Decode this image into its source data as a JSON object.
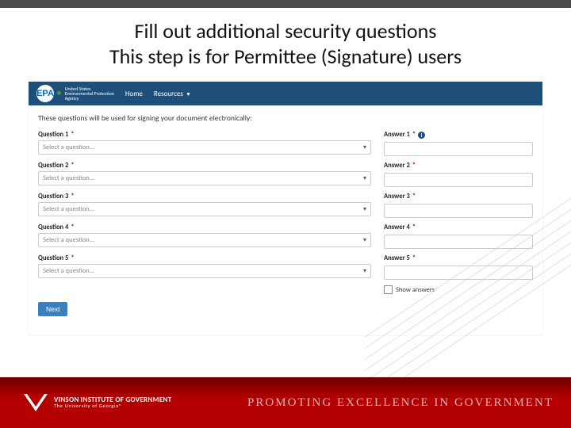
{
  "slide": {
    "title_line1": "Fill out additional security questions",
    "title_line2": "This step is for Permittee (Signature) users"
  },
  "app": {
    "logo_text": "EPA",
    "agency_text": "United States\nEnvironmental Protection\nAgency",
    "nav": {
      "home": "Home",
      "resources": "Resources"
    }
  },
  "form": {
    "intro": "These questions will be used for signing your document electronically:",
    "rows": [
      {
        "q_label": "Question 1",
        "a_label": "Answer 1",
        "placeholder": "Select a question...",
        "info": true
      },
      {
        "q_label": "Question 2",
        "a_label": "Answer 2",
        "placeholder": "Select a question...",
        "info": false
      },
      {
        "q_label": "Question 3",
        "a_label": "Answer 3",
        "placeholder": "Select a question...",
        "info": false
      },
      {
        "q_label": "Question 4",
        "a_label": "Answer 4",
        "placeholder": "Select a question...",
        "info": false
      },
      {
        "q_label": "Question 5",
        "a_label": "Answer 5",
        "placeholder": "Select a question...",
        "info": false
      }
    ],
    "show_answers": "Show answers",
    "next": "Next"
  },
  "footer": {
    "inst_top": "VINSON",
    "inst_main": "INSTITUTE OF GOVERNMENT",
    "inst_sub": "The University of Georgia®",
    "tagline": "PROMOTING EXCELLENCE IN GOVERNMENT"
  }
}
